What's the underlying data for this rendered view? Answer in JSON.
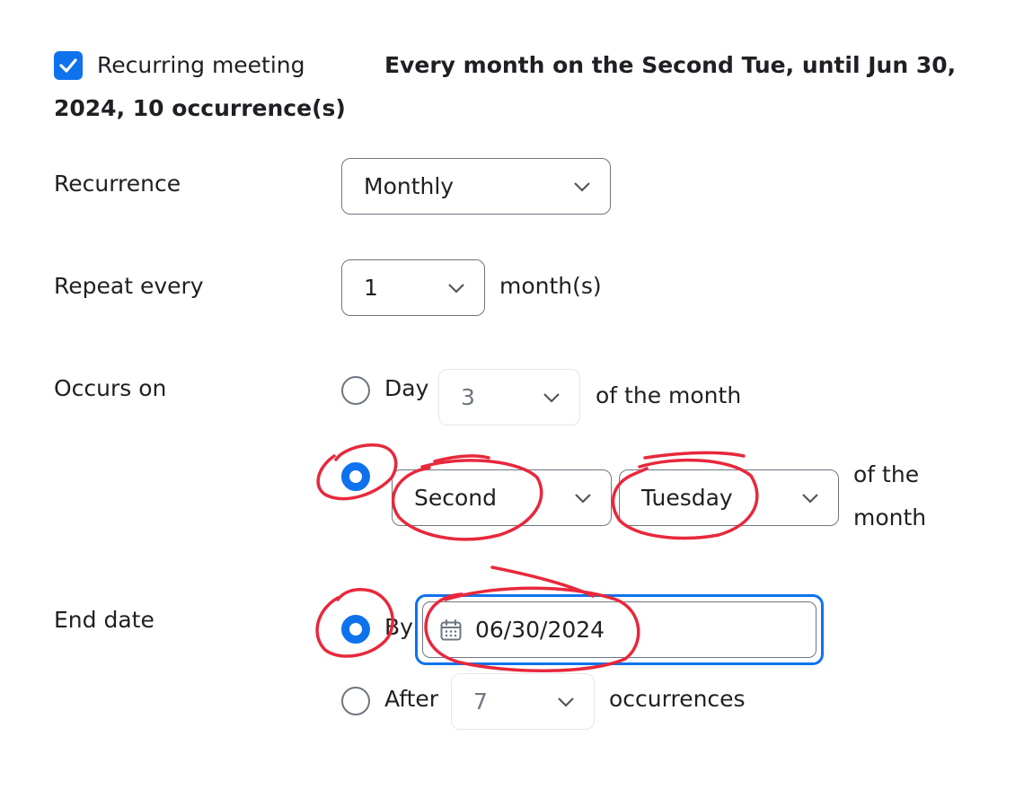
{
  "recurring": {
    "checkbox_label": "Recurring meeting",
    "checked": true,
    "summary": "Every month on the Second Tue, until Jun 30,",
    "summary_cont": "2024, 10 occurrence(s)"
  },
  "recurrence": {
    "label": "Recurrence",
    "value": "Monthly"
  },
  "repeat_every": {
    "label": "Repeat every",
    "value": "1",
    "unit": "month(s)"
  },
  "occurs_on": {
    "label": "Occurs on",
    "day_option": {
      "label": "Day",
      "value": "3",
      "suffix": "of the month",
      "selected": false
    },
    "weekday_option": {
      "ordinal": "Second",
      "weekday": "Tuesday",
      "suffix_line1": "of the",
      "suffix_line2": "month",
      "selected": true
    }
  },
  "end_date": {
    "label": "End date",
    "by_option": {
      "label": "By",
      "value": "06/30/2024",
      "selected": true
    },
    "after_option": {
      "label": "After",
      "value": "7",
      "suffix": "occurrences",
      "selected": false
    }
  },
  "colors": {
    "accent": "#0e72ed",
    "annotation": "#e8283c",
    "border": "#6e7680",
    "text": "#1f1f24"
  }
}
